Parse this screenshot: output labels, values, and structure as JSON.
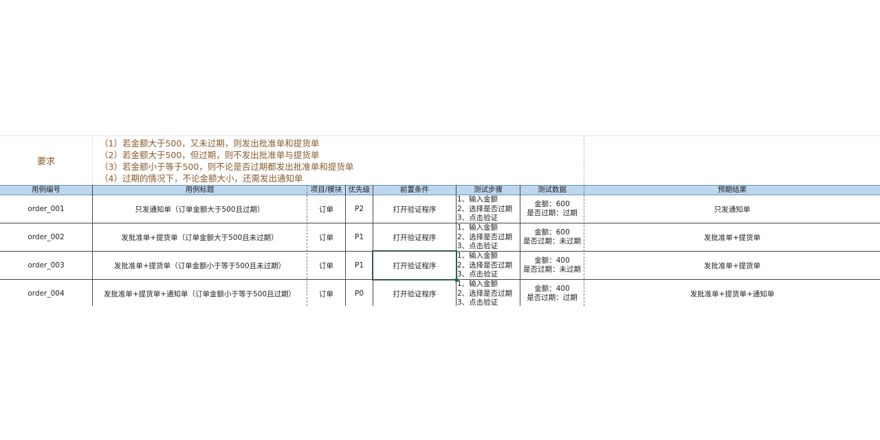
{
  "requirements": {
    "label": "要求",
    "lines": [
      "（1）若金额大于500，又未过期，则发出批准单和提货单",
      "（2）若金额大于500，但过期，则不发出批准单与提货单",
      "（3）若金额小于等于500，则不论是否过期都发出批准单和提货单",
      "（4）过期的情况下，不论金额大小，还需发出通知单"
    ]
  },
  "columns": [
    "用例编号",
    "用例标题",
    "项目/模块",
    "优先级",
    "前置条件",
    "测试步骤",
    "测试数据",
    "预期结果"
  ],
  "rows": [
    {
      "id": "order_001",
      "title": "只发通知单（订单金额大于500且过期）",
      "module": "订单",
      "priority": "P2",
      "precondition": "打开验证程序",
      "steps": [
        "1、输入金额",
        "2、选择是否过期",
        "3、点击验证"
      ],
      "data": [
        "金额：600",
        "是否过期：过期"
      ],
      "expected": "只发通知单"
    },
    {
      "id": "order_002",
      "title": "发批准单+提货单（订单金额大于500且未过期）",
      "module": "订单",
      "priority": "P1",
      "precondition": "打开验证程序",
      "steps": [
        "1、输入金额",
        "2、选择是否过期",
        "3、点击验证"
      ],
      "data": [
        "金额：600",
        "是否过期：未过期"
      ],
      "expected": "发批准单+提货单"
    },
    {
      "id": "order_003",
      "title": "发批准单+提货单（订单金额小于等于500且未过期）",
      "module": "订单",
      "priority": "P1",
      "precondition": "打开验证程序",
      "steps": [
        "1、输入金额",
        "2、选择是否过期",
        "3、点击验证"
      ],
      "data": [
        "金额：400",
        "是否过期：未过期"
      ],
      "expected": "发批准单+提货单"
    },
    {
      "id": "order_004",
      "title": "发批准单+提货单+通知单（订单金额小于等于500且过期）",
      "module": "订单",
      "priority": "P0",
      "precondition": "打开验证程序",
      "steps": [
        "1、输入金额",
        "2、选择是否过期",
        "3、点击验证"
      ],
      "data": [
        "金额：400",
        "是否过期：过期"
      ],
      "expected": "发批准单+提货单+通知单"
    }
  ],
  "colors": {
    "header_bg": "#bdd7ee",
    "requirement_text": "#8a5a2b",
    "selection_border": "#217346"
  }
}
